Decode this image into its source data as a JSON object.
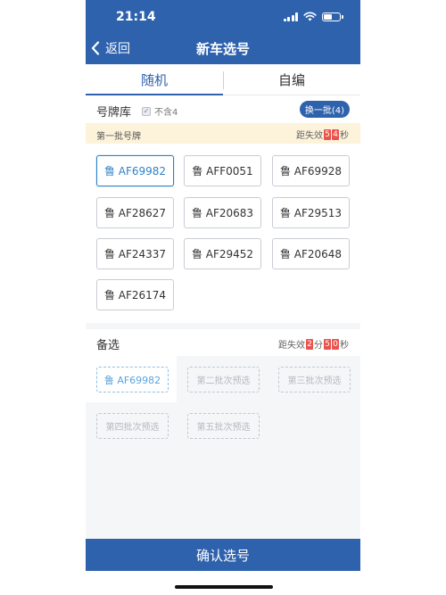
{
  "status_bar": {
    "time": "21:14"
  },
  "nav": {
    "back_label": "返回",
    "title": "新车选号"
  },
  "tabs": [
    {
      "label": "随机",
      "active": true
    },
    {
      "label": "自编",
      "active": false
    }
  ],
  "library": {
    "title": "号牌库",
    "exclude_label": "不含4",
    "swap_button": "换一批(4)"
  },
  "batch": {
    "title": "第一批号牌",
    "timer_prefix": "距失效",
    "timer_digits": [
      "5",
      "4"
    ],
    "timer_suffix": "秒"
  },
  "plates": [
    "鲁 AF69982",
    "鲁 AFF0051",
    "鲁 AF69928",
    "鲁 AF28627",
    "鲁 AF20683",
    "鲁 AF29513",
    "鲁 AF24337",
    "鲁 AF29452",
    "鲁 AF20648",
    "鲁 AF26174"
  ],
  "alternates": {
    "title": "备选",
    "timer_prefix": "距失效",
    "minutes_digit": "2",
    "minutes_label": "分",
    "seconds_digits": [
      "5",
      "0"
    ],
    "seconds_label": "秒",
    "slots": [
      "鲁 AF69982",
      "第二批次预选",
      "第三批次预选",
      "第四批次预选",
      "第五批次预选"
    ]
  },
  "confirm_button": "确认选号",
  "colors": {
    "primary": "#2f62ad",
    "selected": "#2f82c8",
    "timer_digit": "#e9534c",
    "batch_bg": "#fdf3db"
  }
}
